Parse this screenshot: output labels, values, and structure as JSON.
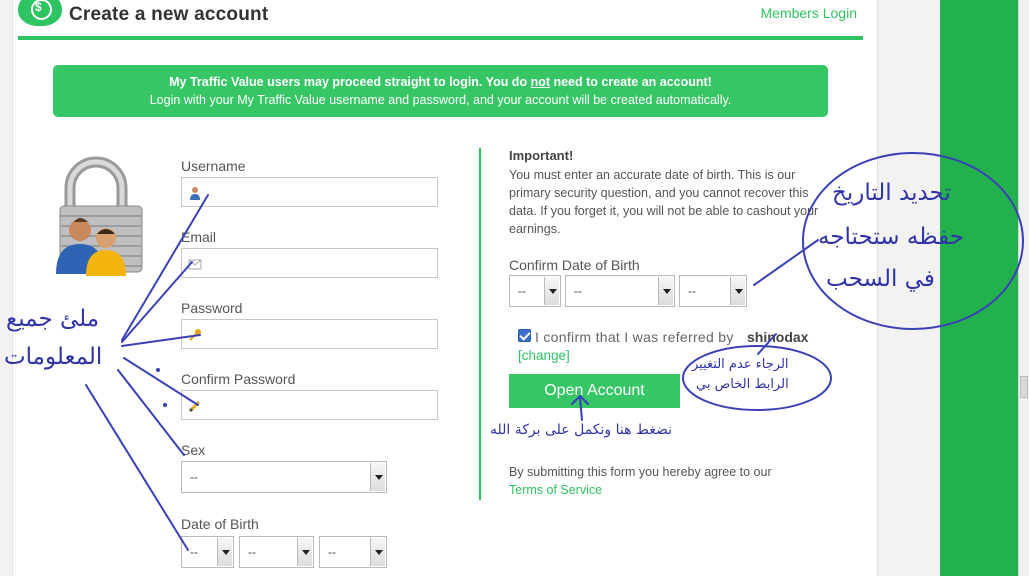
{
  "header": {
    "title": "Create a new account",
    "members_login": "Members Login"
  },
  "notice": {
    "line1_a": "My Traffic Value users may proceed straight to login. You do ",
    "line1_not": "not",
    "line1_b": " need to create an account!",
    "line2": "Login with your My Traffic Value username and password, and your account will be created automatically."
  },
  "form": {
    "username_label": "Username",
    "username_value": "",
    "email_label": "Email",
    "email_value": "",
    "password_label": "Password",
    "password_value": "",
    "confirm_password_label": "Confirm Password",
    "confirm_password_value": "",
    "sex_label": "Sex",
    "sex_value": "--",
    "dob_label": "Date of Birth",
    "dob_day": "--",
    "dob_month": "--",
    "dob_year": "--"
  },
  "important": {
    "title": "Important!",
    "text": "You must enter an accurate date of birth. This is our primary security question, and you cannot recover this data. If you forget it, you will not be able to cashout your earnings.",
    "confirm_dob_label": "Confirm Date of Birth",
    "confirm_day": "--",
    "confirm_month": "--",
    "confirm_year": "--"
  },
  "referral": {
    "checked": true,
    "confirm_text": "I confirm that I was referred by",
    "referrer": "shinodax",
    "change_link": "[change]"
  },
  "actions": {
    "open_account": "Open Account",
    "terms_intro": "By submitting this form you hereby agree to our",
    "terms_link": "Terms of Service"
  },
  "annotations": {
    "fill_line1": "ملئ جميع",
    "fill_line2": "المعلومات",
    "date_line1": "تحديد التاريخ",
    "date_line2": "حفظه ستحتاجه",
    "date_line3": "في السحب",
    "dont_change_line1": "الرجاء عدم التغيير",
    "dont_change_line2": "الرابط الخاص بي",
    "click_here": "نضغط هنا ونكمل على بركة الله"
  },
  "colors": {
    "brand_green": "#2ec462",
    "annotation_ink": "#3034a8"
  }
}
